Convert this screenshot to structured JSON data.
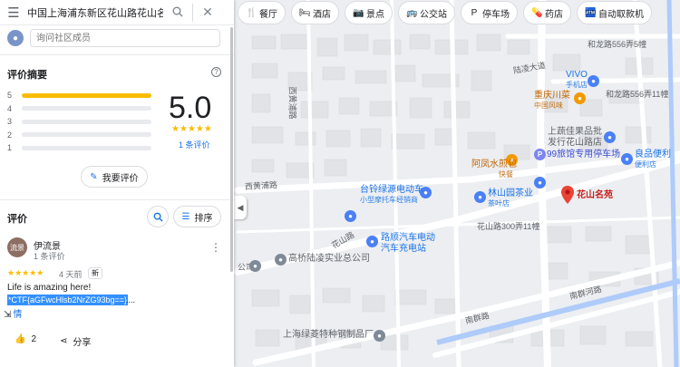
{
  "search": {
    "query": "中国上海浦东新区花山路花山名苑",
    "search_icon": "search-icon",
    "close_icon": "close-icon",
    "menu_icon": "menu-icon"
  },
  "ask": {
    "placeholder": "询问社区成员"
  },
  "rating_summary": {
    "title": "评价摘要",
    "score": "5.0",
    "stars": "★★★★★",
    "review_count": "1 条评价",
    "distribution": [
      {
        "star": "5",
        "fraction": 1.0
      },
      {
        "star": "4",
        "fraction": 0
      },
      {
        "star": "3",
        "fraction": 0
      },
      {
        "star": "2",
        "fraction": 0
      },
      {
        "star": "1",
        "fraction": 0
      }
    ],
    "write_review": "我要评价"
  },
  "reviews_header": {
    "title": "评价",
    "sort_label": "排序"
  },
  "review": {
    "avatar_text": "流景",
    "author": "伊流景",
    "author_sub": "1 条评价",
    "stars": "★★★★★",
    "date": "4 天前",
    "badge": "新",
    "text": "Life is amazing here!",
    "selected_text": "*CTF{aGFwcHlsb2NrZG93bg==}",
    "ellipsis": "....",
    "more_link": "情",
    "like_count": "2",
    "share_label": "分享"
  },
  "chips": [
    {
      "icon": "🍴",
      "label": "餐厅",
      "name": "restaurant"
    },
    {
      "icon": "🛏",
      "label": "酒店",
      "name": "hotel"
    },
    {
      "icon": "📷",
      "label": "景点",
      "name": "attractions"
    },
    {
      "icon": "🚌",
      "label": "公交站",
      "name": "bus-stop"
    },
    {
      "icon": "P",
      "label": "停车场",
      "name": "parking"
    },
    {
      "icon": "💊",
      "label": "药店",
      "name": "pharmacy"
    },
    {
      "icon": "🏧",
      "label": "自动取款机",
      "name": "atm"
    }
  ],
  "map_labels": {
    "road1": "和龙路556弄5幢",
    "road2": "和龙路556弄11幢",
    "lu_ling": "陆凌大道",
    "xi_huang": "西黄浦路",
    "xi_huang2": "西黄浦路",
    "vivo": "VIVO",
    "vivo_sub": "手机店",
    "chongqing": "重庆川菜",
    "chongqing_sub": "中国风味",
    "shangji": "上蔬佳果品批",
    "shangji2": "发行花山路店",
    "parking99": "99旅馆专用停车场",
    "liangpin": "良品便利",
    "liangpin_sub": "便利店",
    "afeng": "阿凤水煎包",
    "afeng_sub": "快餐",
    "tailing": "台铃绿源电动车",
    "tailing_sub": "小型摩托车经销商",
    "linshan": "林山园茶业",
    "linshan_sub": "茶叶店",
    "huashan_mingyuan": "花山名苑",
    "huashan300": "花山路300弄11幢",
    "huashan_road": "花山路",
    "lushun": "路顺汽车电动",
    "lushun2": "汽车充电站",
    "gongsi": "公司",
    "gaoqiao": "高桥陆凌实业总公司",
    "nanqun": "南群路",
    "nanqun2": "南群河路",
    "shanghai_lvling": "上海绿菱特种钢制品厂"
  },
  "colors": {
    "accent": "#1a73e8",
    "star": "#fbbc04",
    "pin_red": "#ea4335",
    "poi_blue": "#4a80f5",
    "poi_orange": "#f29900"
  }
}
